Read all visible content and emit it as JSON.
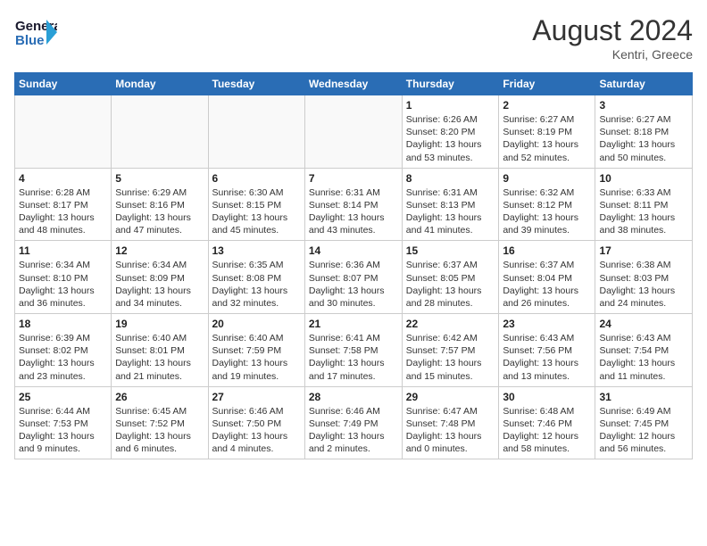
{
  "header": {
    "logo_line1": "General",
    "logo_line2": "Blue",
    "title": "August 2024",
    "subtitle": "Kentri, Greece"
  },
  "weekdays": [
    "Sunday",
    "Monday",
    "Tuesday",
    "Wednesday",
    "Thursday",
    "Friday",
    "Saturday"
  ],
  "weeks": [
    [
      {
        "day": "",
        "info": ""
      },
      {
        "day": "",
        "info": ""
      },
      {
        "day": "",
        "info": ""
      },
      {
        "day": "",
        "info": ""
      },
      {
        "day": "1",
        "info": "Sunrise: 6:26 AM\nSunset: 8:20 PM\nDaylight: 13 hours\nand 53 minutes."
      },
      {
        "day": "2",
        "info": "Sunrise: 6:27 AM\nSunset: 8:19 PM\nDaylight: 13 hours\nand 52 minutes."
      },
      {
        "day": "3",
        "info": "Sunrise: 6:27 AM\nSunset: 8:18 PM\nDaylight: 13 hours\nand 50 minutes."
      }
    ],
    [
      {
        "day": "4",
        "info": "Sunrise: 6:28 AM\nSunset: 8:17 PM\nDaylight: 13 hours\nand 48 minutes."
      },
      {
        "day": "5",
        "info": "Sunrise: 6:29 AM\nSunset: 8:16 PM\nDaylight: 13 hours\nand 47 minutes."
      },
      {
        "day": "6",
        "info": "Sunrise: 6:30 AM\nSunset: 8:15 PM\nDaylight: 13 hours\nand 45 minutes."
      },
      {
        "day": "7",
        "info": "Sunrise: 6:31 AM\nSunset: 8:14 PM\nDaylight: 13 hours\nand 43 minutes."
      },
      {
        "day": "8",
        "info": "Sunrise: 6:31 AM\nSunset: 8:13 PM\nDaylight: 13 hours\nand 41 minutes."
      },
      {
        "day": "9",
        "info": "Sunrise: 6:32 AM\nSunset: 8:12 PM\nDaylight: 13 hours\nand 39 minutes."
      },
      {
        "day": "10",
        "info": "Sunrise: 6:33 AM\nSunset: 8:11 PM\nDaylight: 13 hours\nand 38 minutes."
      }
    ],
    [
      {
        "day": "11",
        "info": "Sunrise: 6:34 AM\nSunset: 8:10 PM\nDaylight: 13 hours\nand 36 minutes."
      },
      {
        "day": "12",
        "info": "Sunrise: 6:34 AM\nSunset: 8:09 PM\nDaylight: 13 hours\nand 34 minutes."
      },
      {
        "day": "13",
        "info": "Sunrise: 6:35 AM\nSunset: 8:08 PM\nDaylight: 13 hours\nand 32 minutes."
      },
      {
        "day": "14",
        "info": "Sunrise: 6:36 AM\nSunset: 8:07 PM\nDaylight: 13 hours\nand 30 minutes."
      },
      {
        "day": "15",
        "info": "Sunrise: 6:37 AM\nSunset: 8:05 PM\nDaylight: 13 hours\nand 28 minutes."
      },
      {
        "day": "16",
        "info": "Sunrise: 6:37 AM\nSunset: 8:04 PM\nDaylight: 13 hours\nand 26 minutes."
      },
      {
        "day": "17",
        "info": "Sunrise: 6:38 AM\nSunset: 8:03 PM\nDaylight: 13 hours\nand 24 minutes."
      }
    ],
    [
      {
        "day": "18",
        "info": "Sunrise: 6:39 AM\nSunset: 8:02 PM\nDaylight: 13 hours\nand 23 minutes."
      },
      {
        "day": "19",
        "info": "Sunrise: 6:40 AM\nSunset: 8:01 PM\nDaylight: 13 hours\nand 21 minutes."
      },
      {
        "day": "20",
        "info": "Sunrise: 6:40 AM\nSunset: 7:59 PM\nDaylight: 13 hours\nand 19 minutes."
      },
      {
        "day": "21",
        "info": "Sunrise: 6:41 AM\nSunset: 7:58 PM\nDaylight: 13 hours\nand 17 minutes."
      },
      {
        "day": "22",
        "info": "Sunrise: 6:42 AM\nSunset: 7:57 PM\nDaylight: 13 hours\nand 15 minutes."
      },
      {
        "day": "23",
        "info": "Sunrise: 6:43 AM\nSunset: 7:56 PM\nDaylight: 13 hours\nand 13 minutes."
      },
      {
        "day": "24",
        "info": "Sunrise: 6:43 AM\nSunset: 7:54 PM\nDaylight: 13 hours\nand 11 minutes."
      }
    ],
    [
      {
        "day": "25",
        "info": "Sunrise: 6:44 AM\nSunset: 7:53 PM\nDaylight: 13 hours\nand 9 minutes."
      },
      {
        "day": "26",
        "info": "Sunrise: 6:45 AM\nSunset: 7:52 PM\nDaylight: 13 hours\nand 6 minutes."
      },
      {
        "day": "27",
        "info": "Sunrise: 6:46 AM\nSunset: 7:50 PM\nDaylight: 13 hours\nand 4 minutes."
      },
      {
        "day": "28",
        "info": "Sunrise: 6:46 AM\nSunset: 7:49 PM\nDaylight: 13 hours\nand 2 minutes."
      },
      {
        "day": "29",
        "info": "Sunrise: 6:47 AM\nSunset: 7:48 PM\nDaylight: 13 hours\nand 0 minutes."
      },
      {
        "day": "30",
        "info": "Sunrise: 6:48 AM\nSunset: 7:46 PM\nDaylight: 12 hours\nand 58 minutes."
      },
      {
        "day": "31",
        "info": "Sunrise: 6:49 AM\nSunset: 7:45 PM\nDaylight: 12 hours\nand 56 minutes."
      }
    ]
  ]
}
